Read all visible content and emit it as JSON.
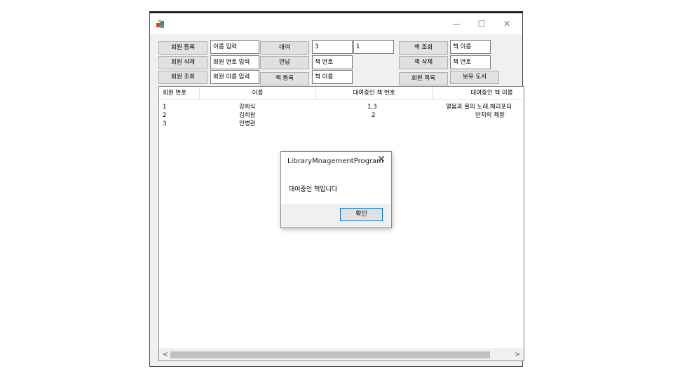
{
  "window": {
    "controls": {
      "minimize": "—",
      "maximize": "☐",
      "close": "✕"
    }
  },
  "toolbar": {
    "register_member": "회원 등록",
    "delete_member": "회원 삭제",
    "search_member": "회원 조회",
    "member_name_input": "이름 입력",
    "member_number_input": "회원 번호 입력",
    "member_name_search_input": "회원 이름 입력",
    "rent_button": "대여",
    "return_button": "반납",
    "register_book_button": "책 등록",
    "rent_member_value": "3",
    "rent_book_value": "1",
    "return_book_input": "책 번호",
    "book_name_input": "책 이름",
    "search_book_button": "책 조회",
    "delete_book_button": "책 삭제",
    "member_list_button": "회원 목록",
    "search_book_input": "책 이름",
    "delete_book_input": "책 번호",
    "owned_books_button": "보유 도서"
  },
  "list": {
    "columns": [
      "회원 번호",
      "이름",
      "대여중인 책 번호",
      "대여중인 책 이름"
    ],
    "rows": [
      {
        "id": "1",
        "name": "강희식",
        "book_ids": "1,3",
        "book_names": "얼음과 불의 노래,해리포터"
      },
      {
        "id": "2",
        "name": "김희창",
        "book_ids": "2",
        "book_names": "반지의 제왕"
      },
      {
        "id": "3",
        "name": "민병관",
        "book_ids": "",
        "book_names": ""
      }
    ]
  },
  "dialog": {
    "title": "LibraryMnagementProgram",
    "message": "대여중인 책입니다",
    "ok_label": "확인",
    "close": "✕"
  }
}
